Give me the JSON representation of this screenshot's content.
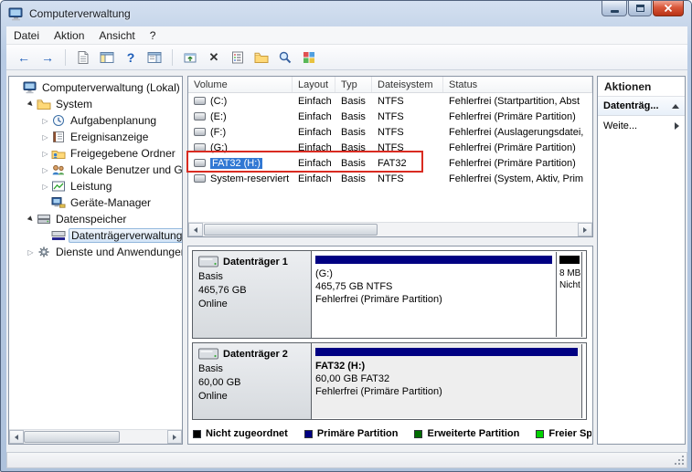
{
  "window": {
    "title": "Computerverwaltung"
  },
  "menu": {
    "items": [
      "Datei",
      "Aktion",
      "Ansicht",
      "?"
    ]
  },
  "toolbar": {
    "icon_names": [
      "back",
      "forward",
      "export-list",
      "console-tree",
      "help",
      "action-pane",
      "up-level",
      "delete",
      "properties",
      "open-folder",
      "search",
      "customize"
    ],
    "glyphs": {
      "back": "←",
      "forward": "→",
      "help": "?",
      "delete": "✕"
    }
  },
  "tree": {
    "items": [
      {
        "label": "Computerverwaltung (Lokal)"
      },
      {
        "label": "System"
      },
      {
        "label": "Aufgabenplanung"
      },
      {
        "label": "Ereignisanzeige"
      },
      {
        "label": "Freigegebene Ordner"
      },
      {
        "label": "Lokale Benutzer und Gruppen"
      },
      {
        "label": "Leistung"
      },
      {
        "label": "Geräte-Manager"
      },
      {
        "label": "Datenspeicher"
      },
      {
        "label": "Datenträgerverwaltung"
      },
      {
        "label": "Dienste und Anwendungen"
      }
    ]
  },
  "volumes": {
    "columns": [
      "Volume",
      "Layout",
      "Typ",
      "Dateisystem",
      "Status"
    ],
    "rows": [
      {
        "volume": "(C:)",
        "layout": "Einfach",
        "typ": "Basis",
        "dateisystem": "NTFS",
        "status": "Fehlerfrei (Startpartition, Abst"
      },
      {
        "volume": "(E:)",
        "layout": "Einfach",
        "typ": "Basis",
        "dateisystem": "NTFS",
        "status": "Fehlerfrei (Primäre Partition)"
      },
      {
        "volume": "(F:)",
        "layout": "Einfach",
        "typ": "Basis",
        "dateisystem": "NTFS",
        "status": "Fehlerfrei (Auslagerungsdatei,"
      },
      {
        "volume": "(G:)",
        "layout": "Einfach",
        "typ": "Basis",
        "dateisystem": "NTFS",
        "status": "Fehlerfrei (Primäre Partition)"
      },
      {
        "volume": "FAT32 (H:)",
        "layout": "Einfach",
        "typ": "Basis",
        "dateisystem": "FAT32",
        "status": "Fehlerfrei (Primäre Partition)"
      },
      {
        "volume": "System-reserviert",
        "layout": "Einfach",
        "typ": "Basis",
        "dateisystem": "NTFS",
        "status": "Fehlerfrei (System, Aktiv, Prim"
      }
    ]
  },
  "disks": [
    {
      "name": "Datenträger 1",
      "type": "Basis",
      "size": "465,76 GB",
      "state": "Online",
      "partitions": [
        {
          "label": "(G:)",
          "size": "465,75 GB NTFS",
          "status": "Fehlerfrei (Primäre Partition)"
        }
      ],
      "unallocated": {
        "size": "8 MB",
        "status": "Nicht zugeordnet"
      }
    },
    {
      "name": "Datenträger 2",
      "type": "Basis",
      "size": "60,00 GB",
      "state": "Online",
      "partitions": [
        {
          "label": "FAT32  (H:)",
          "size": "60,00 GB FAT32",
          "status": "Fehlerfrei (Primäre Partition)"
        }
      ]
    }
  ],
  "legend": {
    "items": [
      {
        "label": "Nicht zugeordnet",
        "color": "#000000"
      },
      {
        "label": "Primäre Partition",
        "color": "#000082"
      },
      {
        "label": "Erweiterte Partition",
        "color": "#006b00"
      },
      {
        "label": "Freier Speicher",
        "color": "#00d200"
      }
    ]
  },
  "actions": {
    "title": "Aktionen",
    "sections": [
      {
        "label": "Datenträg..."
      },
      {
        "label": "Weite..."
      }
    ]
  }
}
